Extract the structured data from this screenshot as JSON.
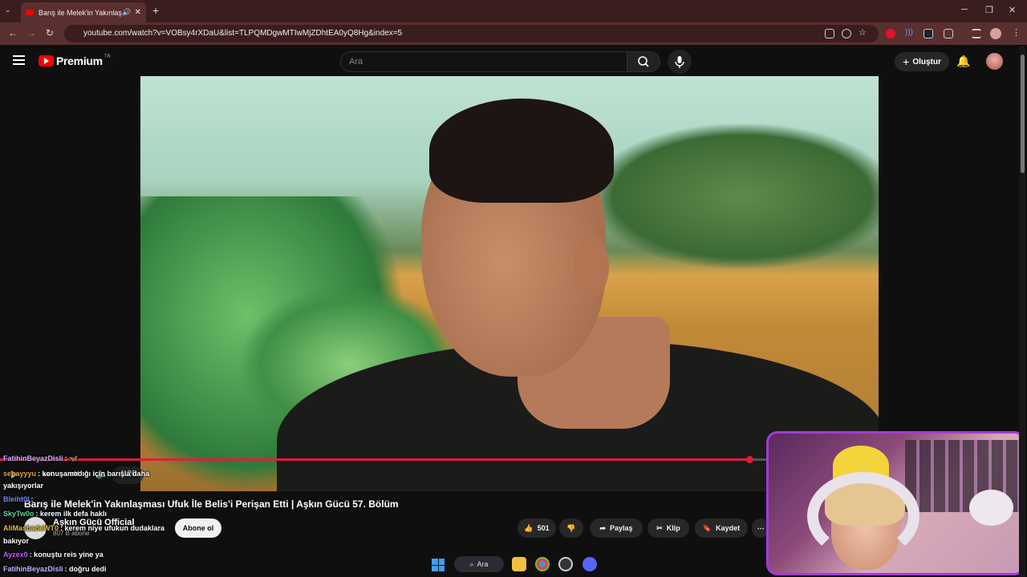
{
  "browser": {
    "tab_title": "Barış ile Melek'in Yakınlaşma",
    "url": "youtube.com/watch?v=VOBsy4rXDaU&list=TLPQMDgwMTIwMjZDhtEA0yQ8Hg&index=5"
  },
  "youtube": {
    "logo_text": "Premium",
    "logo_region": "TR",
    "search_placeholder": "Ara",
    "create_label": "Oluştur"
  },
  "video": {
    "time": "1:26",
    "title": "Barış ile Melek'in Yakınlaşması Ufuk İle Belis'i Perişan Etti | Aşkın Gücü 57. Bölüm",
    "progress": 0.975,
    "channel_name": "Aşkın Gücü Official",
    "subscribers": "807 B abone",
    "subscribe_label": "Abone ol",
    "like_count": "501",
    "share_label": "Paylaş",
    "clip_label": "Klip",
    "save_label": "Kaydet"
  },
  "chat": [
    {
      "user": "FatihinBeyazDisli",
      "msg": ": 🦋",
      "color": "#c9b3ff"
    },
    {
      "user": "senayyyu",
      "msg": ": konuşamadığı için barışla daha",
      "color": "#e0a140"
    },
    {
      "user": "",
      "msg": "yakışıyorlar",
      "color": "#ffffff"
    },
    {
      "user": "Bleiht0I",
      "msg": ":",
      "color": "#6a8cff"
    },
    {
      "user": "SkyTw0o",
      "msg": ": kerem ilk defa haklı",
      "color": "#5ad6a0"
    },
    {
      "user": "AliMasbadeWT0",
      "msg": ": kerem niye ufukun dudaklara",
      "color": "#e0c040"
    },
    {
      "user": "",
      "msg": "bakıyor",
      "color": "#ffffff"
    },
    {
      "user": "Ayzex0",
      "msg": ": konuştu reis yine ya",
      "color": "#c060ff"
    },
    {
      "user": "FatihinBeyazDisli",
      "msg": ": doğru dedi",
      "color": "#c9b3ff"
    }
  ],
  "taskbar": {
    "search_label": "Ara"
  }
}
